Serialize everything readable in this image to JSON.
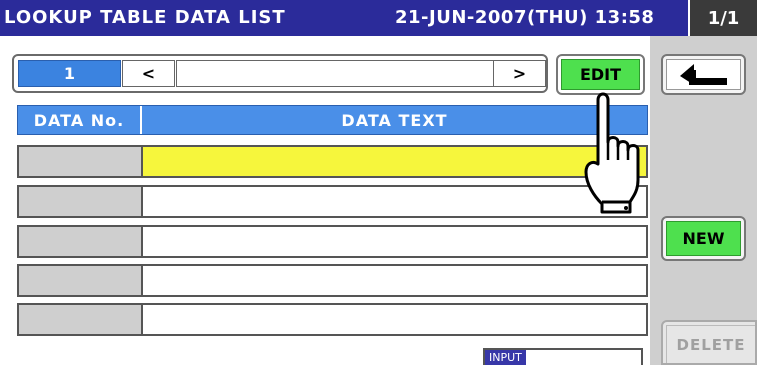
{
  "titlebar": {
    "title": "LOOKUP TABLE DATA LIST",
    "datetime": "21-JUN-2007(THU) 13:58",
    "page": "1/1"
  },
  "nav": {
    "page_number": "1",
    "prev_label": "<",
    "next_label": ">"
  },
  "buttons": {
    "edit": "EDIT",
    "back_icon": "return-arrow-icon",
    "new": "NEW",
    "delete": "DELETE"
  },
  "table": {
    "headers": [
      "DATA No.",
      "DATA TEXT"
    ],
    "rows": [
      {
        "no": "",
        "text": "",
        "selected": true
      },
      {
        "no": "",
        "text": "",
        "selected": false
      },
      {
        "no": "",
        "text": "",
        "selected": false
      },
      {
        "no": "",
        "text": "",
        "selected": false
      },
      {
        "no": "",
        "text": "",
        "selected": false
      }
    ]
  },
  "input_field": {
    "label": "INPUT",
    "value": ""
  },
  "overlay": {
    "icon": "pointing-hand-icon"
  },
  "colors": {
    "titlebar": "#2b2b9a",
    "header": "#4a8fe8",
    "selected_row": "#f6f63c",
    "green_button": "#4ee04e",
    "page_indicator": "#3b83e0"
  }
}
